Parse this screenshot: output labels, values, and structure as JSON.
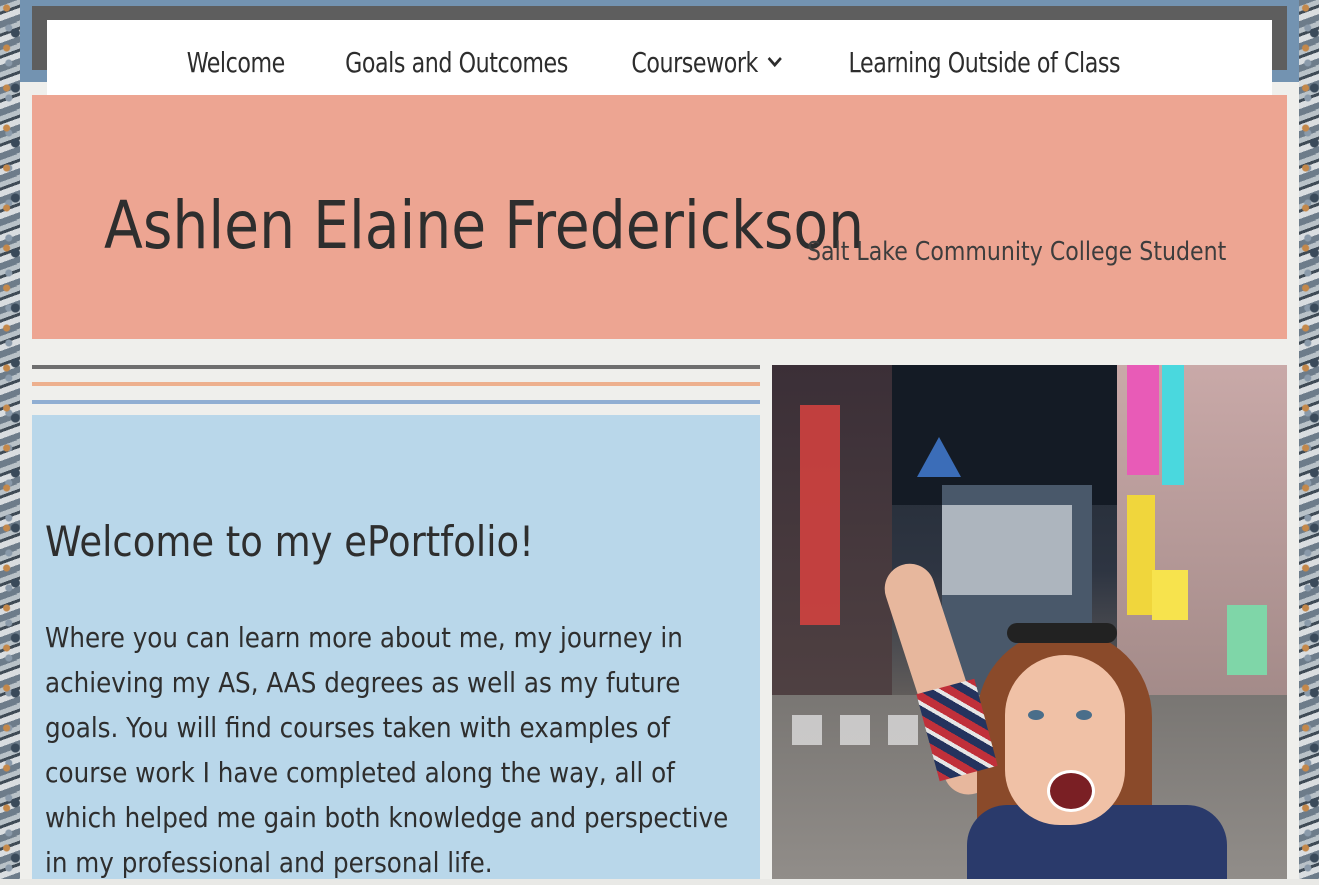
{
  "nav": {
    "items": [
      {
        "label": "Welcome"
      },
      {
        "label": "Goals and Outcomes"
      },
      {
        "label": "Coursework",
        "has_dropdown": true,
        "icon": "chevron-down-icon"
      },
      {
        "label": "Learning Outside of Class"
      }
    ]
  },
  "header": {
    "title": "Ashlen Elaine Frederickson",
    "tagline": "Salt Lake Community College Student"
  },
  "welcome": {
    "heading": "Welcome to my ePortfolio!",
    "body": "Where you can learn more about me, my journey in achieving my AS, AAS degrees as well as my future goals. You will find courses taken with examples of course work I have completed along the way, all of which helped me gain both knowledge and perspective in my professional and personal life."
  },
  "colors": {
    "header_bg": "#eda592",
    "welcome_bg": "#b9d7ea",
    "top_band": "#7393b1",
    "rule_gray": "#6e6e6e",
    "rule_peach": "#edb08e",
    "rule_blue": "#90aed2"
  }
}
